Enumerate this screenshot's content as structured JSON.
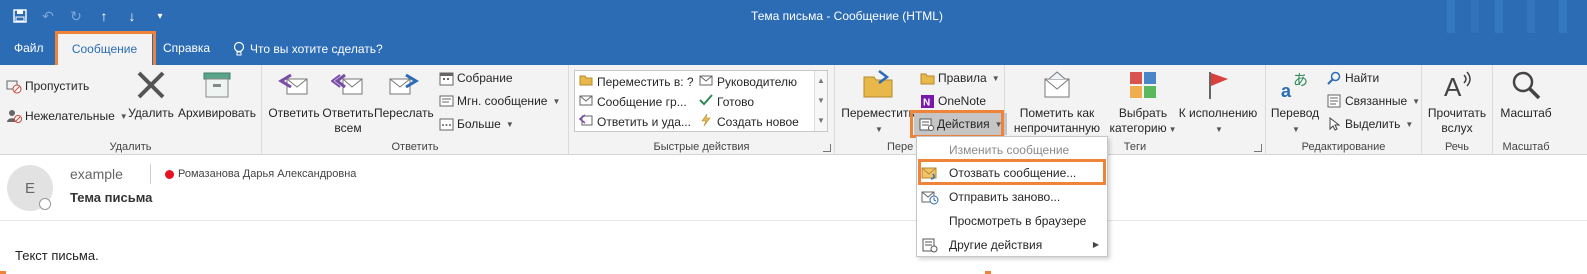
{
  "window": {
    "title": "Тема письма  -  Сообщение (HTML)"
  },
  "tabs": [
    {
      "label": "Файл"
    },
    {
      "label": "Сообщение"
    },
    {
      "label": "Справка"
    },
    {
      "label": "Что вы хотите сделать?"
    }
  ],
  "groups": {
    "delete": {
      "label": "Удалить",
      "ignore": "Пропустить",
      "junk": "Нежелательные",
      "delete": "Удалить",
      "archive": "Архивировать"
    },
    "respond": {
      "label": "Ответить",
      "reply": "Ответить",
      "reply_all_line1": "Ответить",
      "reply_all_line2": "всем",
      "forward": "Переслать",
      "meeting": "Собрание",
      "im": "Мгн. сообщение",
      "more": "Больше"
    },
    "quick_steps": {
      "label": "Быстрые действия",
      "items": [
        "Переместить в: ?",
        "Руководителю",
        "Сообщение гр...",
        "Готово",
        "Ответить и уда...",
        "Создать новое"
      ]
    },
    "move": {
      "label": "Пере",
      "move": "Переместить",
      "rules": "Правила",
      "onenote": "OneNote",
      "actions": "Действия"
    },
    "tags": {
      "label": "Теги",
      "mark_unread_line1": "Пометить как",
      "mark_unread_line2": "непрочитанную",
      "categorize_line1": "Выбрать",
      "categorize_line2": "категорию",
      "followup": "К исполнению"
    },
    "editing": {
      "label": "Редактирование",
      "translate": "Перевод",
      "find": "Найти",
      "related": "Связанные",
      "select": "Выделить"
    },
    "speech": {
      "label": "Речь",
      "read_line1": "Прочитать",
      "read_line2": "вслух"
    },
    "zoom": {
      "label": "Масштаб",
      "zoom": "Масштаб"
    }
  },
  "actions_menu": {
    "items": [
      {
        "label": "Изменить сообщение",
        "enabled": false
      },
      {
        "label": "Отозвать сообщение...",
        "enabled": true
      },
      {
        "label": "Отправить заново...",
        "enabled": true
      },
      {
        "label": "Просмотреть в браузере",
        "enabled": true
      },
      {
        "label": "Другие действия",
        "enabled": true
      }
    ]
  },
  "message": {
    "avatar_initial": "E",
    "from": "example",
    "to": "Ромазанова Дарья Александровна",
    "subject": "Тема письма",
    "body": "Текст письма."
  },
  "colors": {
    "title_bar": "#2b6cb5",
    "ribbon": "#f3f3f3",
    "highlight": "#f0833a",
    "presence_busy": "#e81123"
  }
}
